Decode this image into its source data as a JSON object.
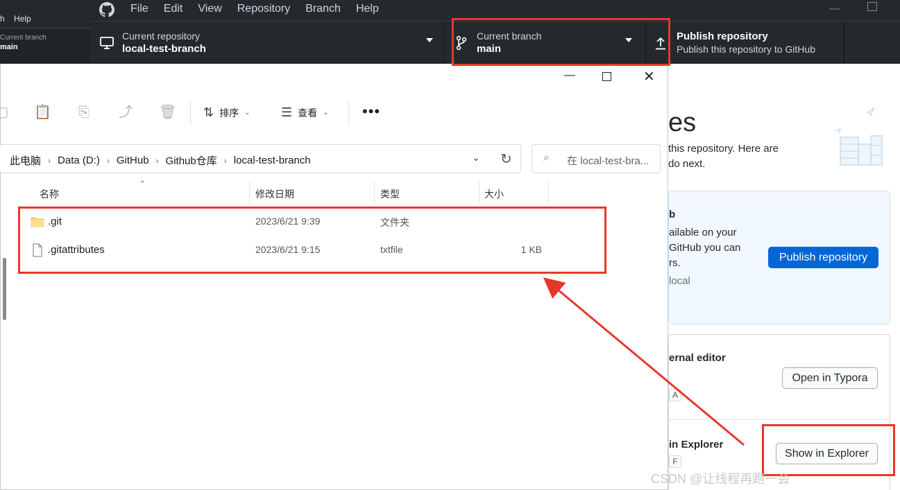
{
  "bg_app": {
    "menu": [
      "h",
      "Help"
    ],
    "branch_label": "Current branch",
    "branch_value": "main"
  },
  "github_desktop": {
    "menu": [
      "File",
      "Edit",
      "View",
      "Repository",
      "Branch",
      "Help"
    ],
    "toolbar": {
      "repo_label": "Current repository",
      "repo_value": "local-test-branch",
      "branch_label": "Current branch",
      "branch_value": "main",
      "publish_title": "Publish repository",
      "publish_desc": "Publish this repository to GitHub"
    },
    "content": {
      "heading_fragment": "es",
      "sub_line1": "this repository. Here are",
      "sub_line2": "do next.",
      "publish_card": {
        "title_fragment": "b",
        "desc_line1": "ailable on your",
        "desc_line2": "GitHub you can",
        "desc_line3": "rs.",
        "hint_fragment": "local",
        "button": "Publish repository"
      },
      "editor_row": {
        "title_fragment": "ernal editor",
        "shortcut_key": "A",
        "button": "Open in Typora"
      },
      "explorer_row": {
        "title_fragment": "in Explorer",
        "shortcut_key": "F",
        "button": "Show in Explorer"
      }
    },
    "watermark": "CSDN @让线程再跑一会"
  },
  "explorer": {
    "toolbar": {
      "sort_label": "排序",
      "view_label": "查看",
      "more": "•••"
    },
    "breadcrumbs": [
      "此电脑",
      "Data (D:)",
      "GitHub",
      "Github仓库",
      "local-test-branch"
    ],
    "search_placeholder": "在 local-test-bra...",
    "columns": [
      "名称",
      "修改日期",
      "类型",
      "大小"
    ],
    "files": [
      {
        "name": ".git",
        "modified": "2023/6/21 9:39",
        "type": "文件夹",
        "size": "",
        "icon": "folder-icon"
      },
      {
        "name": ".gitattributes",
        "modified": "2023/6/21 9:15",
        "type": "txtfile",
        "size": "1 KB",
        "icon": "file-icon"
      }
    ]
  },
  "colors": {
    "github_dark": "#24292e",
    "accent_blue": "#0366d6",
    "annotation_red": "#e8372a",
    "folder_yellow": "#f8d775"
  }
}
